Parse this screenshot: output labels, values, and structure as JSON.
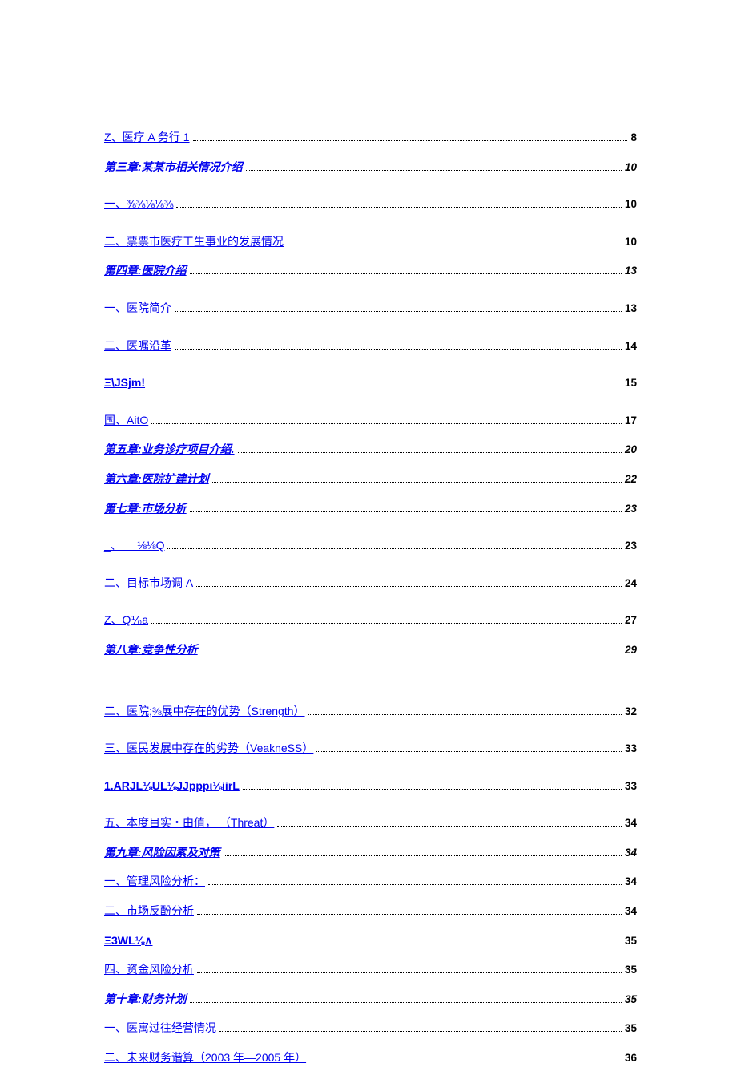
{
  "toc": [
    {
      "label": "Z、医疗 A 务行 1",
      "page": "8",
      "style": "link",
      "pageStyle": "bold",
      "spacerBefore": ""
    },
    {
      "label": "第三章:某某市相关情况介绍",
      "page": "10",
      "style": "italic",
      "pageStyle": "italic",
      "spacerBefore": ""
    },
    {
      "label": "一、⅜⅜⅛⅛⅜",
      "page": "10",
      "style": "link",
      "pageStyle": "bold",
      "spacerBefore": "sm"
    },
    {
      "label": "二、票票市医疗工生事业的发展情况",
      "page": "10",
      "style": "link",
      "pageStyle": "bold",
      "spacerBefore": "sm"
    },
    {
      "label": "第四章:医院介绍",
      "page": "13",
      "style": "italic",
      "pageStyle": "italic",
      "spacerBefore": ""
    },
    {
      "label": "一、医院简介",
      "page": "13",
      "style": "link",
      "pageStyle": "bold",
      "spacerBefore": "sm"
    },
    {
      "label": "二、医嘱沿革",
      "page": "14",
      "style": "link",
      "pageStyle": "bold",
      "spacerBefore": "sm"
    },
    {
      "label": "Ξ\\JSjm!",
      "page": "15",
      "style": "blue-bold",
      "pageStyle": "bold",
      "spacerBefore": "sm"
    },
    {
      "label": "国、AitO",
      "page": "17",
      "style": "link",
      "pageStyle": "bold",
      "spacerBefore": "sm"
    },
    {
      "label": "第五章:业务诊疗项目介绍.",
      "page": "20",
      "style": "italic",
      "pageStyle": "italic",
      "spacerBefore": ""
    },
    {
      "label": "第六章:医院扩建计划",
      "page": "22",
      "style": "italic",
      "pageStyle": "italic",
      "spacerBefore": ""
    },
    {
      "label": "第七章:市场分析",
      "page": "23",
      "style": "italic",
      "pageStyle": "italic",
      "spacerBefore": ""
    },
    {
      "label": "_、     ⅛⅛Q",
      "page": "23",
      "style": "link",
      "pageStyle": "bold",
      "spacerBefore": "sm"
    },
    {
      "label": "二、目标市场调 A",
      "page": "24",
      "style": "link",
      "pageStyle": "bold",
      "spacerBefore": "sm"
    },
    {
      "label": "Z、Q⅟₀a",
      "page": "27",
      "style": "link",
      "pageStyle": "bold",
      "spacerBefore": "sm"
    },
    {
      "label": "第八章:竞争性分析",
      "page": "29",
      "style": "italic",
      "pageStyle": "italic",
      "spacerBefore": ""
    },
    {
      "label": "二、医院;⅜展中存在的优势（Strength）",
      "page": "32",
      "style": "link",
      "pageStyle": "bold",
      "spacerBefore": "lg"
    },
    {
      "label": "三、医民发展中存在的劣势（VeakneSS）",
      "page": "33",
      "style": "link",
      "pageStyle": "bold",
      "spacerBefore": "sm"
    },
    {
      "label": "1.ARJL⅛UL⅛JJpppι⅛iirL",
      "page": "33",
      "style": "blue-bold",
      "pageStyle": "bold",
      "spacerBefore": "sm"
    },
    {
      "label": "五、本度目实・由值， （Threat）",
      "page": "34",
      "style": "link",
      "pageStyle": "bold",
      "spacerBefore": "sm"
    },
    {
      "label": "第九章:风险因素及对策",
      "page": "34",
      "style": "italic",
      "pageStyle": "italic",
      "spacerBefore": ""
    },
    {
      "label": "一、管理风险分析：",
      "page": "34",
      "style": "link",
      "pageStyle": "bold",
      "spacerBefore": ""
    },
    {
      "label": "二、市场反酚分析",
      "page": "34",
      "style": "link",
      "pageStyle": "bold",
      "spacerBefore": ""
    },
    {
      "label": "Ξ3WL⅛∧",
      "page": "35",
      "style": "blue-bold",
      "pageStyle": "bold",
      "spacerBefore": ""
    },
    {
      "label": "四、资金风险分析",
      "page": "35",
      "style": "link",
      "pageStyle": "bold",
      "spacerBefore": ""
    },
    {
      "label": "第十章:财务计划",
      "page": "35",
      "style": "italic",
      "pageStyle": "italic",
      "spacerBefore": ""
    },
    {
      "label": "一、医寓过往经营情况",
      "page": "35",
      "style": "link",
      "pageStyle": "bold",
      "spacerBefore": ""
    },
    {
      "label": "二、未来财务谐算（2003 年—2005 年）",
      "page": "36",
      "style": "link",
      "pageStyle": "bold",
      "spacerBefore": ""
    }
  ]
}
